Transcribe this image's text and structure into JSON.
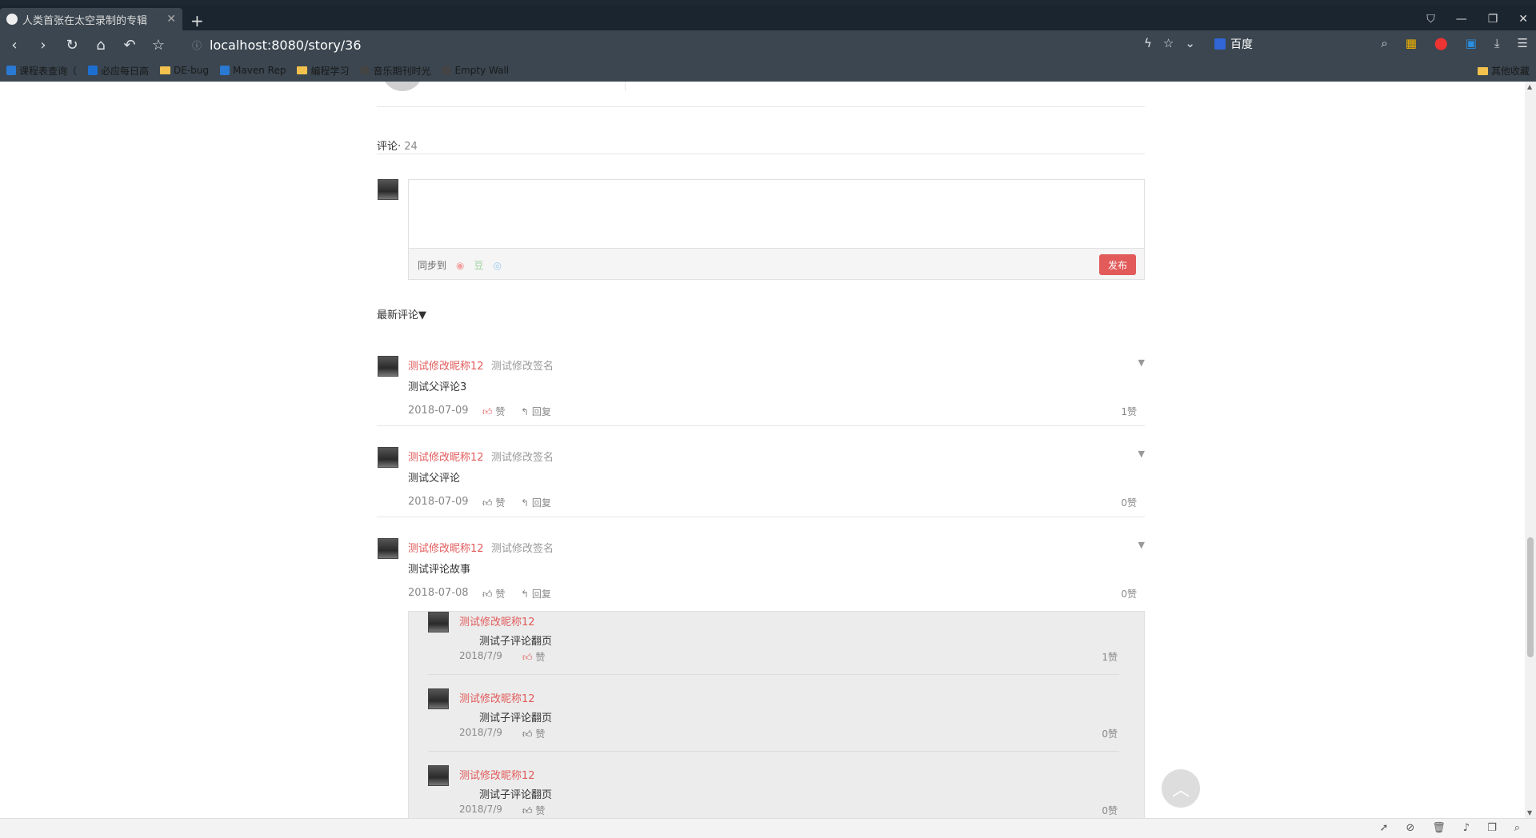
{
  "browser": {
    "tab_title": "人类首张在太空录制的专辑",
    "tab_close": "✕",
    "new_tab": "+",
    "url": "localhost:8080/story/36",
    "search_engine": "百度",
    "bookmarks": [
      "课程表查询（",
      "必应每日高",
      "DE-bug",
      "Maven Rep",
      "编程学习",
      "音乐期刊时光",
      "Empty Wall"
    ],
    "bookmarks_right": "其他收藏"
  },
  "comments": {
    "label": "评论·",
    "count": "24",
    "sync_label": "同步到",
    "publish_label": "发布",
    "sort_label": "最新评论▼",
    "items": [
      {
        "nick": "测试修改昵称12",
        "sign": "测试修改签名",
        "text": "测试父评论3",
        "date": "2018-07-09",
        "like_label": "赞",
        "reply_label": "回复",
        "count": "1赞"
      },
      {
        "nick": "测试修改昵称12",
        "sign": "测试修改签名",
        "text": "测试父评论",
        "date": "2018-07-09",
        "like_label": "赞",
        "reply_label": "回复",
        "count": "0赞"
      },
      {
        "nick": "测试修改昵称12",
        "sign": "测试修改签名",
        "text": "测试评论故事",
        "date": "2018-07-08",
        "like_label": "赞",
        "reply_label": "回复",
        "count": "0赞"
      }
    ],
    "replies": [
      {
        "nick": "测试修改昵称12",
        "text": "测试子评论翻页",
        "date": "2018/7/9",
        "like_label": "赞",
        "count": "1赞"
      },
      {
        "nick": "测试修改昵称12",
        "text": "测试子评论翻页",
        "date": "2018/7/9",
        "like_label": "赞",
        "count": "0赞"
      },
      {
        "nick": "测试修改昵称12",
        "text": "测试子评论翻页",
        "date": "2018/7/9",
        "like_label": "赞",
        "count": "0赞"
      }
    ]
  }
}
